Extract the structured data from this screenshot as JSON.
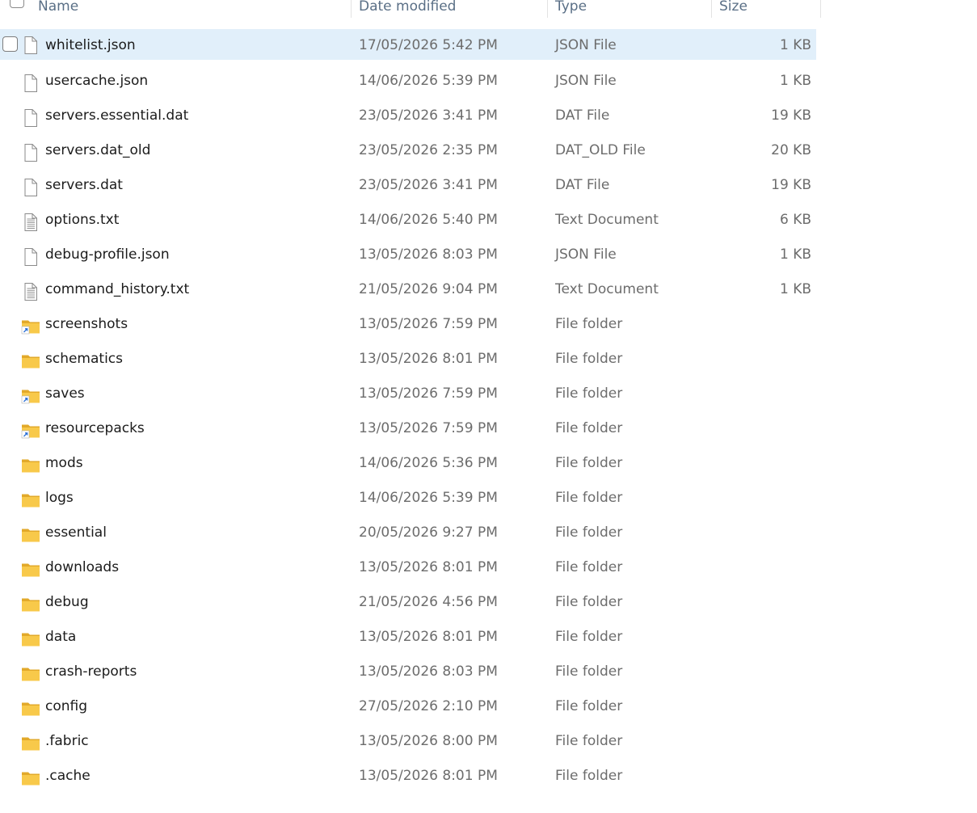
{
  "columns": {
    "name": "Name",
    "date": "Date modified",
    "type": "Type",
    "size": "Size"
  },
  "colors": {
    "selection": "#e1effa",
    "folder": "#f8c94a",
    "shortcut_arrow": "#2a6fd6"
  },
  "files": [
    {
      "name": "whitelist.json",
      "date": "17/05/2026 5:42 PM",
      "type": "JSON File",
      "size": "1 KB",
      "icon": "file-icon",
      "selected": true
    },
    {
      "name": "usercache.json",
      "date": "14/06/2026 5:39 PM",
      "type": "JSON File",
      "size": "1 KB",
      "icon": "file-icon"
    },
    {
      "name": "servers.essential.dat",
      "date": "23/05/2026 3:41 PM",
      "type": "DAT File",
      "size": "19 KB",
      "icon": "file-icon"
    },
    {
      "name": "servers.dat_old",
      "date": "23/05/2026 2:35 PM",
      "type": "DAT_OLD File",
      "size": "20 KB",
      "icon": "file-icon"
    },
    {
      "name": "servers.dat",
      "date": "23/05/2026 3:41 PM",
      "type": "DAT File",
      "size": "19 KB",
      "icon": "file-icon"
    },
    {
      "name": "options.txt",
      "date": "14/06/2026 5:40 PM",
      "type": "Text Document",
      "size": "6 KB",
      "icon": "text-file-icon"
    },
    {
      "name": "debug-profile.json",
      "date": "13/05/2026 8:03 PM",
      "type": "JSON File",
      "size": "1 KB",
      "icon": "file-icon"
    },
    {
      "name": "command_history.txt",
      "date": "21/05/2026 9:04 PM",
      "type": "Text Document",
      "size": "1 KB",
      "icon": "text-file-icon"
    },
    {
      "name": "screenshots",
      "date": "13/05/2026 7:59 PM",
      "type": "File folder",
      "size": "",
      "icon": "folder-shortcut-icon"
    },
    {
      "name": "schematics",
      "date": "13/05/2026 8:01 PM",
      "type": "File folder",
      "size": "",
      "icon": "folder-icon"
    },
    {
      "name": "saves",
      "date": "13/05/2026 7:59 PM",
      "type": "File folder",
      "size": "",
      "icon": "folder-shortcut-icon"
    },
    {
      "name": "resourcepacks",
      "date": "13/05/2026 7:59 PM",
      "type": "File folder",
      "size": "",
      "icon": "folder-shortcut-icon"
    },
    {
      "name": "mods",
      "date": "14/06/2026 5:36 PM",
      "type": "File folder",
      "size": "",
      "icon": "folder-icon"
    },
    {
      "name": "logs",
      "date": "14/06/2026 5:39 PM",
      "type": "File folder",
      "size": "",
      "icon": "folder-icon"
    },
    {
      "name": "essential",
      "date": "20/05/2026 9:27 PM",
      "type": "File folder",
      "size": "",
      "icon": "folder-icon"
    },
    {
      "name": "downloads",
      "date": "13/05/2026 8:01 PM",
      "type": "File folder",
      "size": "",
      "icon": "folder-icon"
    },
    {
      "name": "debug",
      "date": "21/05/2026 4:56 PM",
      "type": "File folder",
      "size": "",
      "icon": "folder-icon"
    },
    {
      "name": "data",
      "date": "13/05/2026 8:01 PM",
      "type": "File folder",
      "size": "",
      "icon": "folder-icon"
    },
    {
      "name": "crash-reports",
      "date": "13/05/2026 8:03 PM",
      "type": "File folder",
      "size": "",
      "icon": "folder-icon"
    },
    {
      "name": "config",
      "date": "27/05/2026 2:10 PM",
      "type": "File folder",
      "size": "",
      "icon": "folder-icon"
    },
    {
      "name": ".fabric",
      "date": "13/05/2026 8:00 PM",
      "type": "File folder",
      "size": "",
      "icon": "folder-icon"
    },
    {
      "name": ".cache",
      "date": "13/05/2026 8:01 PM",
      "type": "File folder",
      "size": "",
      "icon": "folder-icon"
    }
  ]
}
